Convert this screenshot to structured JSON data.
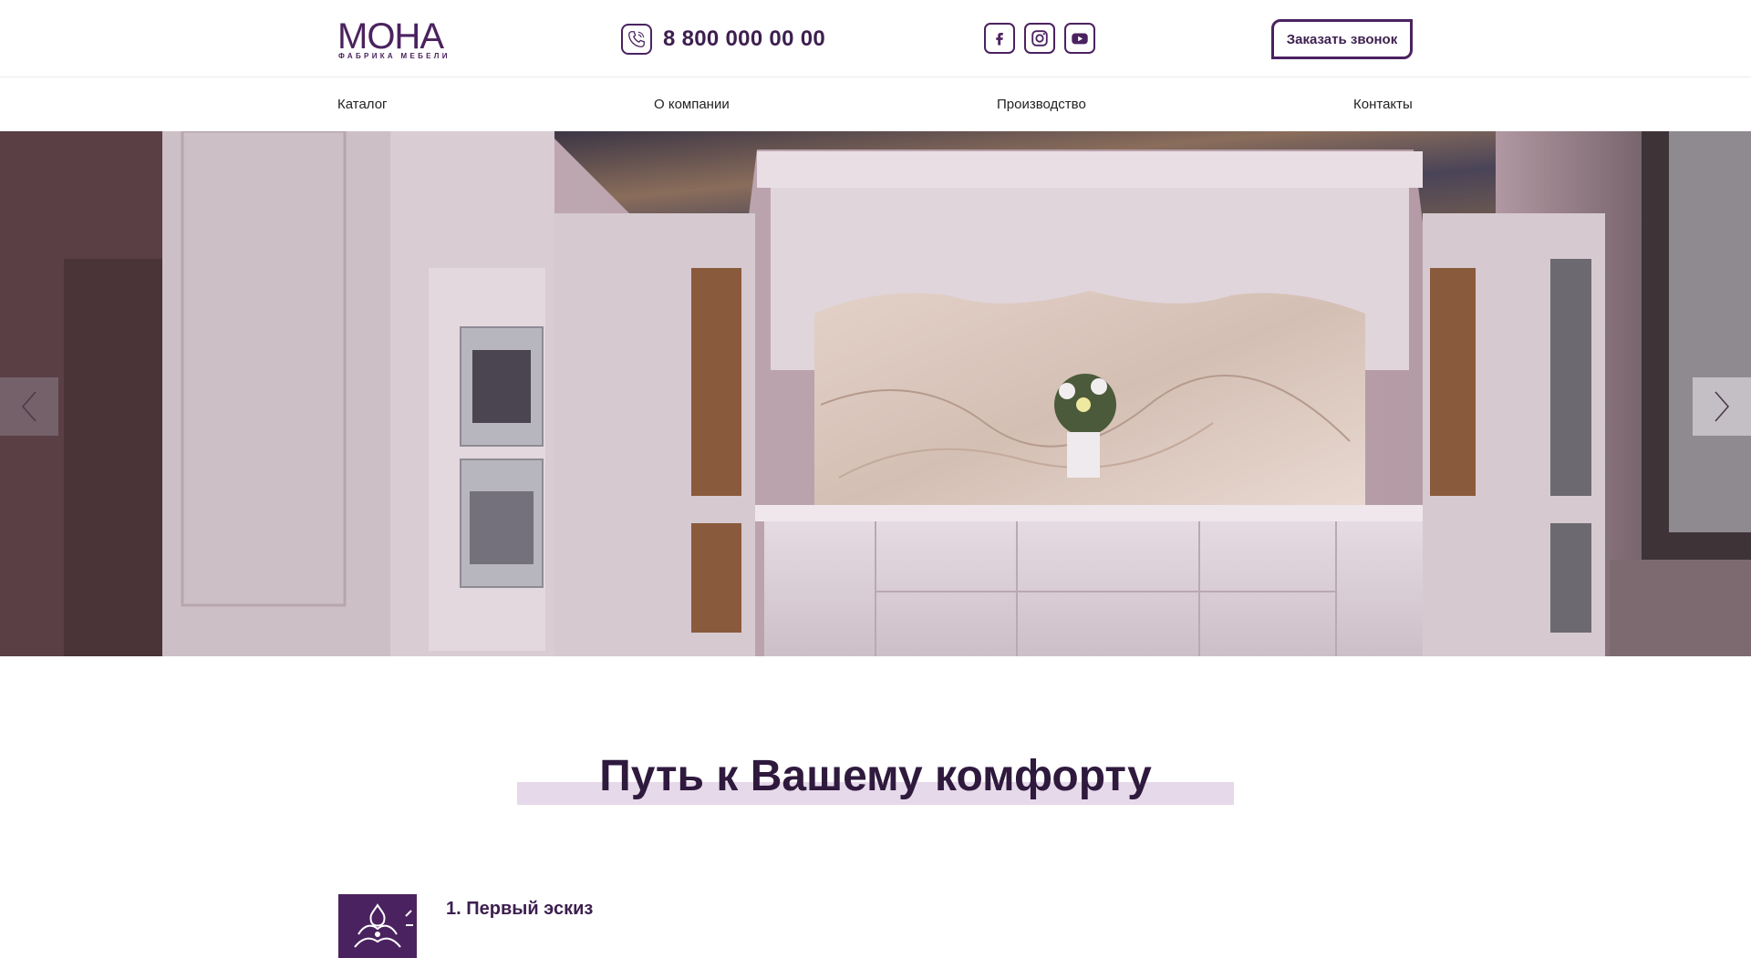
{
  "brand": {
    "name": "МОНА",
    "tagline": "ФАБРИКА МЕБЕЛИ",
    "accent": "#4b2260"
  },
  "header": {
    "phone": "8 800 000 00 00",
    "phone_icon": "phone-icon",
    "socials": [
      {
        "name": "facebook",
        "icon": "facebook-icon"
      },
      {
        "name": "instagram",
        "icon": "instagram-icon"
      },
      {
        "name": "youtube",
        "icon": "youtube-icon"
      }
    ],
    "call_button": "Заказать звонок"
  },
  "nav": {
    "items": [
      "Каталог",
      "О компании",
      "Производство",
      "Контакты"
    ]
  },
  "hero": {
    "image": "white-classic-kitchen-photo",
    "prev_icon": "chevron-left-icon",
    "next_icon": "chevron-right-icon"
  },
  "section": {
    "title": "Путь к Вашему комфорту",
    "highlight": "#e6d9ea",
    "steps": [
      {
        "title": "1. Первый эскиз",
        "icon": "crown-ornament-icon"
      }
    ]
  }
}
